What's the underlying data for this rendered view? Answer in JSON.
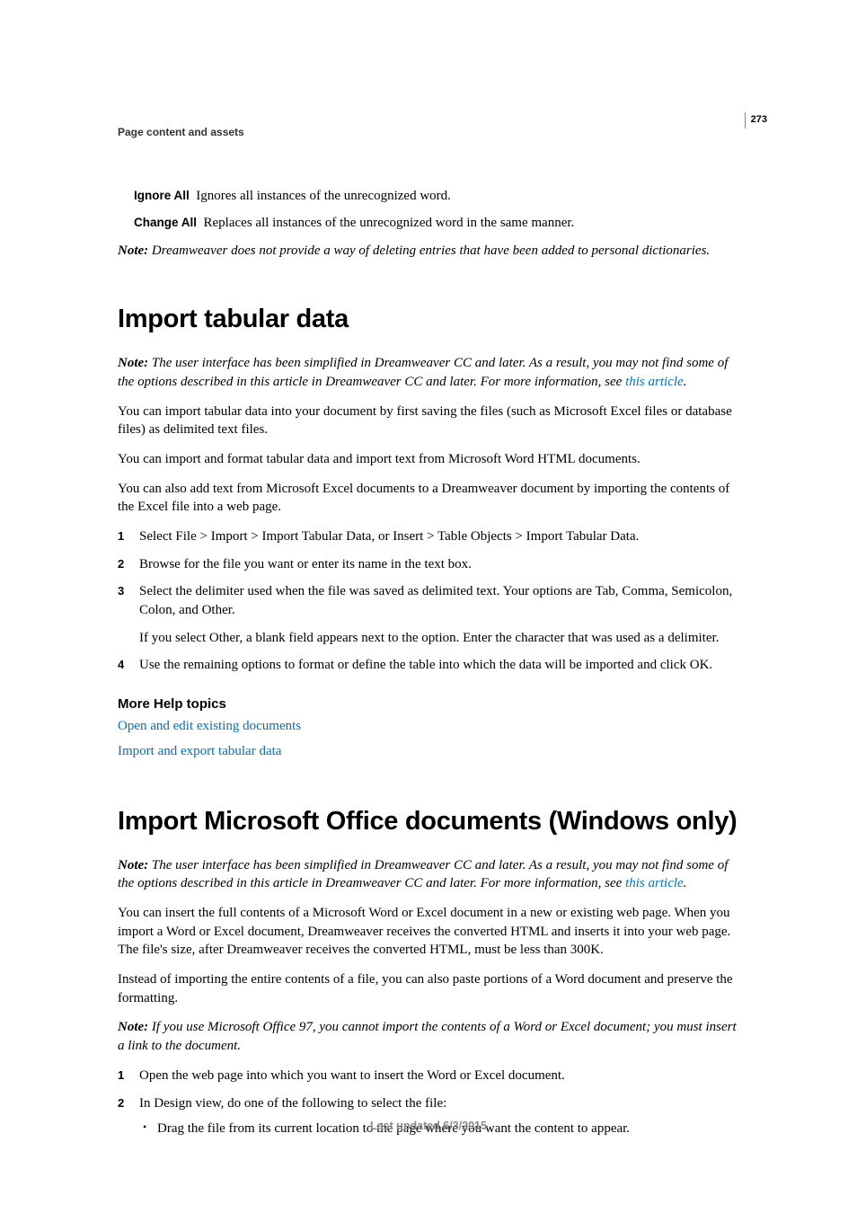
{
  "page_number": "273",
  "section_header": "Page content and assets",
  "definitions": [
    {
      "term": "Ignore All",
      "desc": "Ignores all instances of the unrecognized word."
    },
    {
      "term": "Change All",
      "desc": "Replaces all instances of the unrecognized word in the same manner."
    }
  ],
  "note_top": {
    "label": "Note:",
    "text": " Dreamweaver does not provide a way of deleting entries that have been added to personal dictionaries."
  },
  "section1": {
    "heading": "Import tabular data",
    "note": {
      "label": "Note:",
      "text_before_link": " The user interface has been simplified in Dreamweaver CC and later. As a result, you may not find some of the options described in this article in Dreamweaver CC and later. For more information, see ",
      "link": "this article",
      "after": "."
    },
    "p1": "You can import tabular data into your document by first saving the files (such as Microsoft Excel files or database files) as delimited text files.",
    "p2": "You can import and format tabular data and import text from Microsoft Word HTML documents.",
    "p3": "You can also add text from Microsoft Excel documents to a Dreamweaver document by importing the contents of the Excel file into a web page.",
    "steps": [
      "Select File > Import > Import Tabular Data, or Insert > Table Objects > Import Tabular Data.",
      "Browse for the file you want or enter its name in the text box.",
      "Select the delimiter used when the file was saved as delimited text. Your options are Tab, Comma, Semicolon, Colon, and Other.",
      "Use the remaining options to format or define the table into which the data will be imported and click OK."
    ],
    "step3_sub": "If you select Other, a blank field appears next to the option. Enter the character that was used as a delimiter.",
    "more_help_heading": "More Help topics",
    "more_help_links": [
      "Open and edit existing documents",
      "Import and export tabular data"
    ]
  },
  "section2": {
    "heading": "Import Microsoft Office documents (Windows only)",
    "note": {
      "label": "Note:",
      "text_before_link": " The user interface has been simplified in Dreamweaver CC and later. As a result, you may not find some of the options described in this article in Dreamweaver CC and later. For more information, see ",
      "link": "this article",
      "after": "."
    },
    "p1": "You can insert the full contents of a Microsoft Word or Excel document in a new or existing web page. When you import a Word or Excel document, Dreamweaver receives the converted HTML and inserts it into your web page. The file's size, after Dreamweaver receives the converted HTML, must be less than 300K.",
    "p2": "Instead of importing the entire contents of a file, you can also paste portions of a Word document and preserve the formatting.",
    "note2": {
      "label": "Note:",
      "text": " If you use Microsoft Office 97, you cannot import the contents of a Word or Excel document; you must insert a link to the document."
    },
    "steps": [
      "Open the web page into which you want to insert the Word or Excel document.",
      "In Design view, do one of the following to select the file:"
    ],
    "step2_bullet": "Drag the file from its current location to the page where you want the content to appear."
  },
  "footer": "Last updated 6/3/2015"
}
